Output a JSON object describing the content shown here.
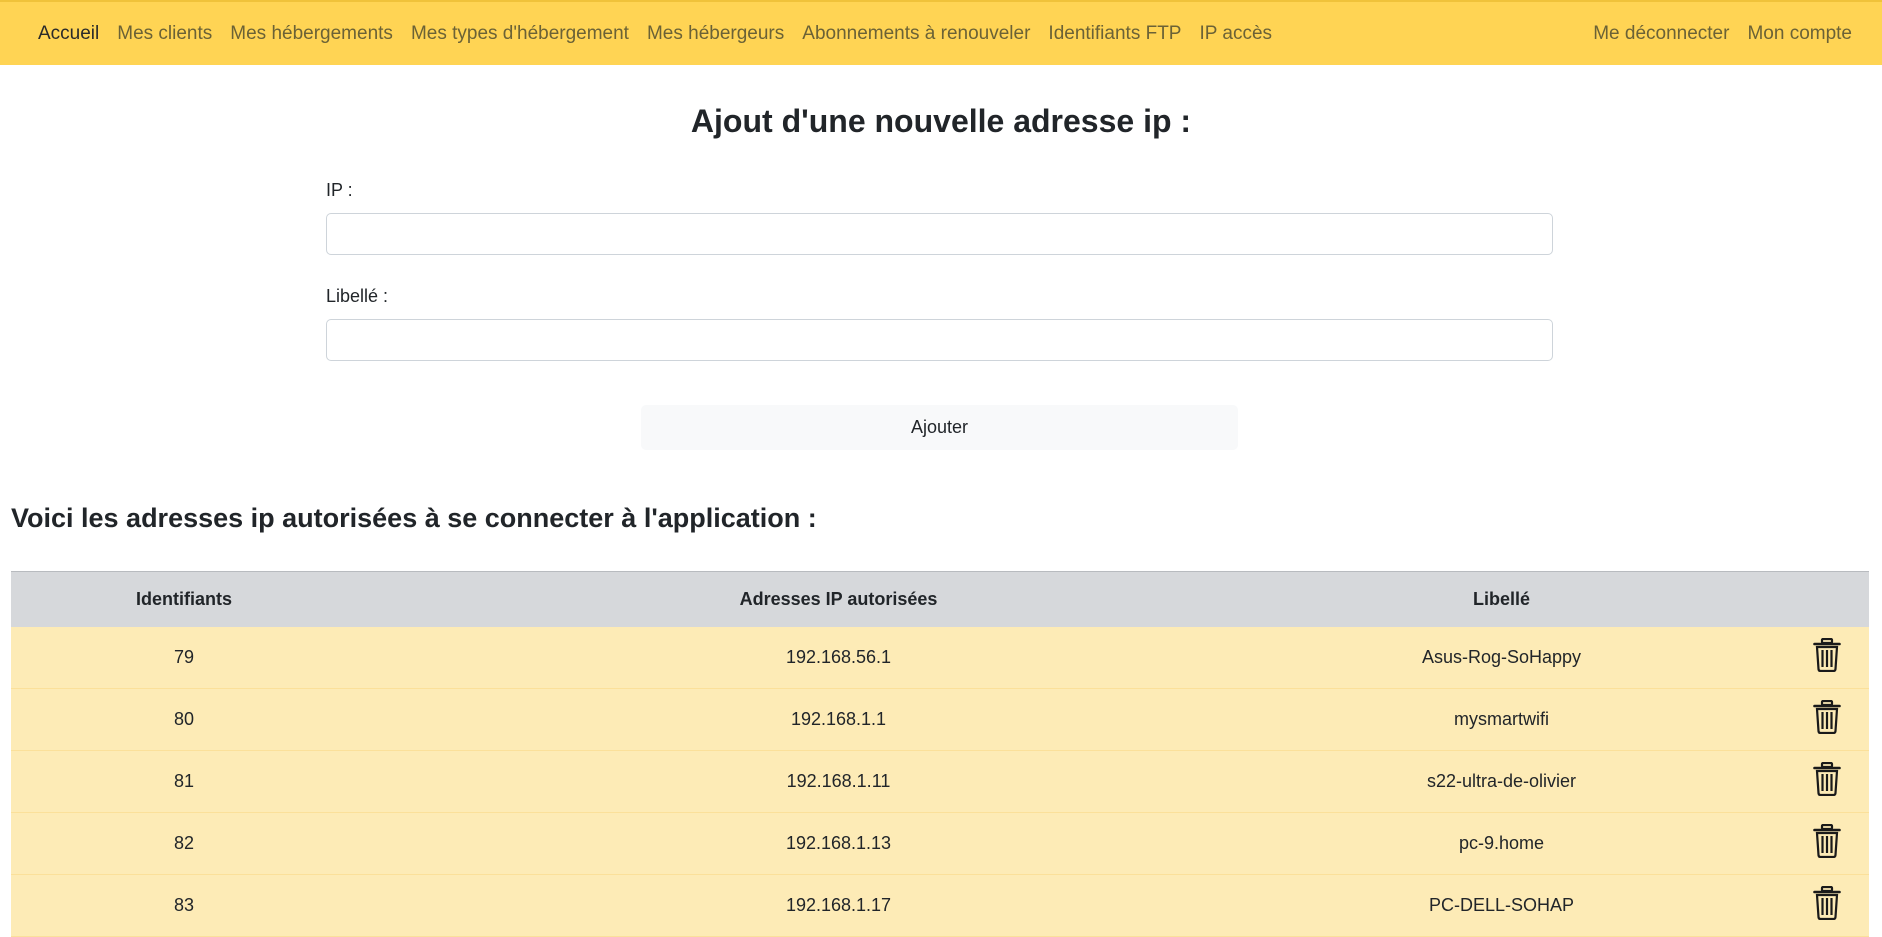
{
  "nav": {
    "left": [
      "Accueil",
      "Mes clients",
      "Mes hébergements",
      "Mes types d'hébergement",
      "Mes hébergeurs",
      "Abonnements à renouveler",
      "Identifiants FTP",
      "IP accès"
    ],
    "right": [
      "Me déconnecter",
      "Mon compte"
    ],
    "active": "Accueil"
  },
  "form": {
    "title": "Ajout d'une nouvelle adresse ip :",
    "ip_label": "IP :",
    "ip_value": "",
    "libelle_label": "Libellé :",
    "libelle_value": "",
    "submit_label": "Ajouter"
  },
  "list": {
    "title": "Voici les adresses ip autorisées à se connecter à l'application :",
    "headers": [
      "Identifiants",
      "Adresses IP autorisées",
      "Libellé",
      ""
    ],
    "rows": [
      {
        "id": "79",
        "ip": "192.168.56.1",
        "libelle": "Asus-Rog-SoHappy"
      },
      {
        "id": "80",
        "ip": "192.168.1.1",
        "libelle": "mysmartwifi"
      },
      {
        "id": "81",
        "ip": "192.168.1.11",
        "libelle": "s22-ultra-de-olivier"
      },
      {
        "id": "82",
        "ip": "192.168.1.13",
        "libelle": "pc-9.home"
      },
      {
        "id": "83",
        "ip": "192.168.1.17",
        "libelle": "PC-DELL-SOHAP"
      }
    ],
    "row_action_icon": "trash-icon"
  },
  "colors": {
    "navbar": "#ffd454",
    "table_header": "#d6d8db",
    "table_row": "#fdebb6"
  }
}
